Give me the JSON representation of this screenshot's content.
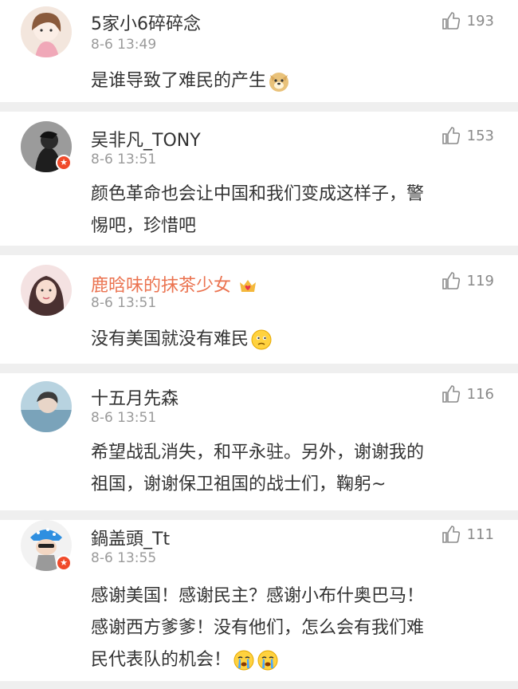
{
  "comments": [
    {
      "name": "5家小6碎碎念",
      "time": "8-6 13:49",
      "likes": "193",
      "lines": [
        "是谁导致了难民的产生"
      ],
      "emoji": "dog-doge-emoji",
      "verified": false
    },
    {
      "name": "吴非凡_TONY",
      "time": "8-6 13:51",
      "likes": "153",
      "lines": [
        "颜色革命也会让中国和我们变成这样子，警",
        "惕吧，珍惜吧"
      ],
      "verified": true
    },
    {
      "name": "鹿晗味的抹茶少女",
      "time": "8-6 13:51",
      "likes": "119",
      "lines": [
        "没有美国就没有难民"
      ],
      "emoji": "sad-face-emoji",
      "name_color": "#eb7350",
      "badge": "crown-heart-badge",
      "verified": false
    },
    {
      "name": "十五月先森",
      "time": "8-6 13:51",
      "likes": "116",
      "lines": [
        "希望战乱消失，和平永驻。另外，谢谢我的",
        "祖国，谢谢保卫祖国的战士们，鞠躬~"
      ],
      "verified": false
    },
    {
      "name": "鍋盖頭_Tt",
      "time": "8-6 13:55",
      "likes": "111",
      "lines": [
        "感谢美国！感谢民主？感谢小布什奥巴马！",
        "感谢西方爹爹！没有他们，怎么会有我们难",
        "民代表队的机会！"
      ],
      "emoji": "crying-face-emoji",
      "verified": true
    }
  ],
  "colors": {
    "vip_name": "#eb7350",
    "verified_badge": "#f04a2a",
    "text": "#333333",
    "meta": "#9a9a9a"
  },
  "icons": {
    "like": "thumbs-up-icon",
    "verified": "verified-v-icon"
  }
}
